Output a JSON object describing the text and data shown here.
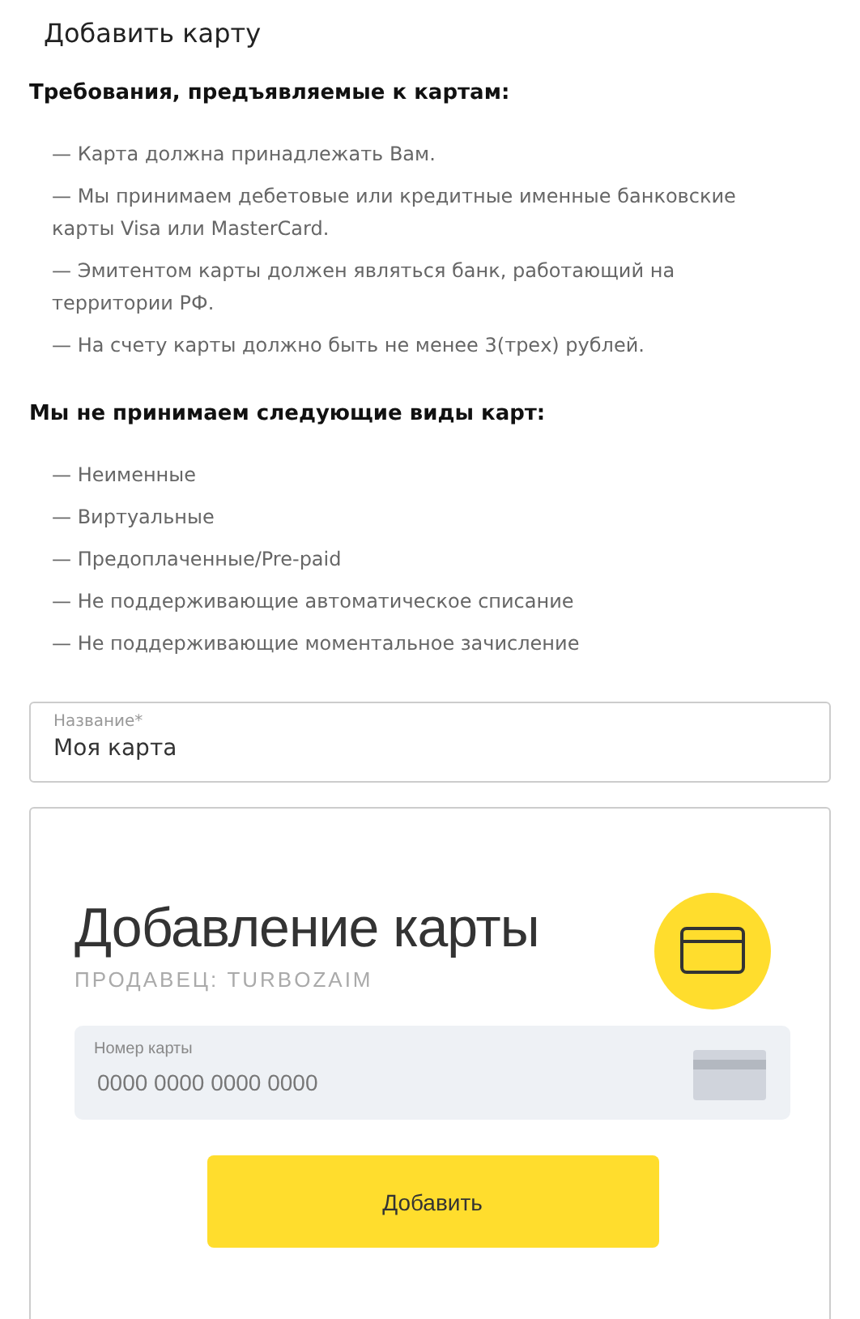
{
  "title": "Добавить карту",
  "requirements": {
    "heading": "Требования, предъявляемые к картам:",
    "items": [
      "— Карта должна принадлежать Вам.",
      "— Мы принимаем дебетовые или кредитные именные банковские карты Visa или MasterCard.",
      "— Эмитентом карты должен являться банк, работающий на территории РФ.",
      "— На счету карты должно быть не менее 3(трех) рублей."
    ]
  },
  "not_accepted": {
    "heading": "Мы не принимаем следующие виды карт:",
    "items": [
      "— Неименные",
      "— Виртуальные",
      "— Предоплаченные/Pre-paid",
      "— Не поддерживающие автоматическое списание",
      "— Не поддерживающие моментальное зачисление"
    ]
  },
  "name_field": {
    "label": "Название*",
    "value": "Моя карта"
  },
  "payment_widget": {
    "title": "Добавление карты",
    "seller": "ПРОДАВЕЦ: TURBOZAIM",
    "card_number": {
      "label": "Номер карты",
      "placeholder": "0000 0000 0000 0000"
    },
    "submit": "Добавить"
  }
}
